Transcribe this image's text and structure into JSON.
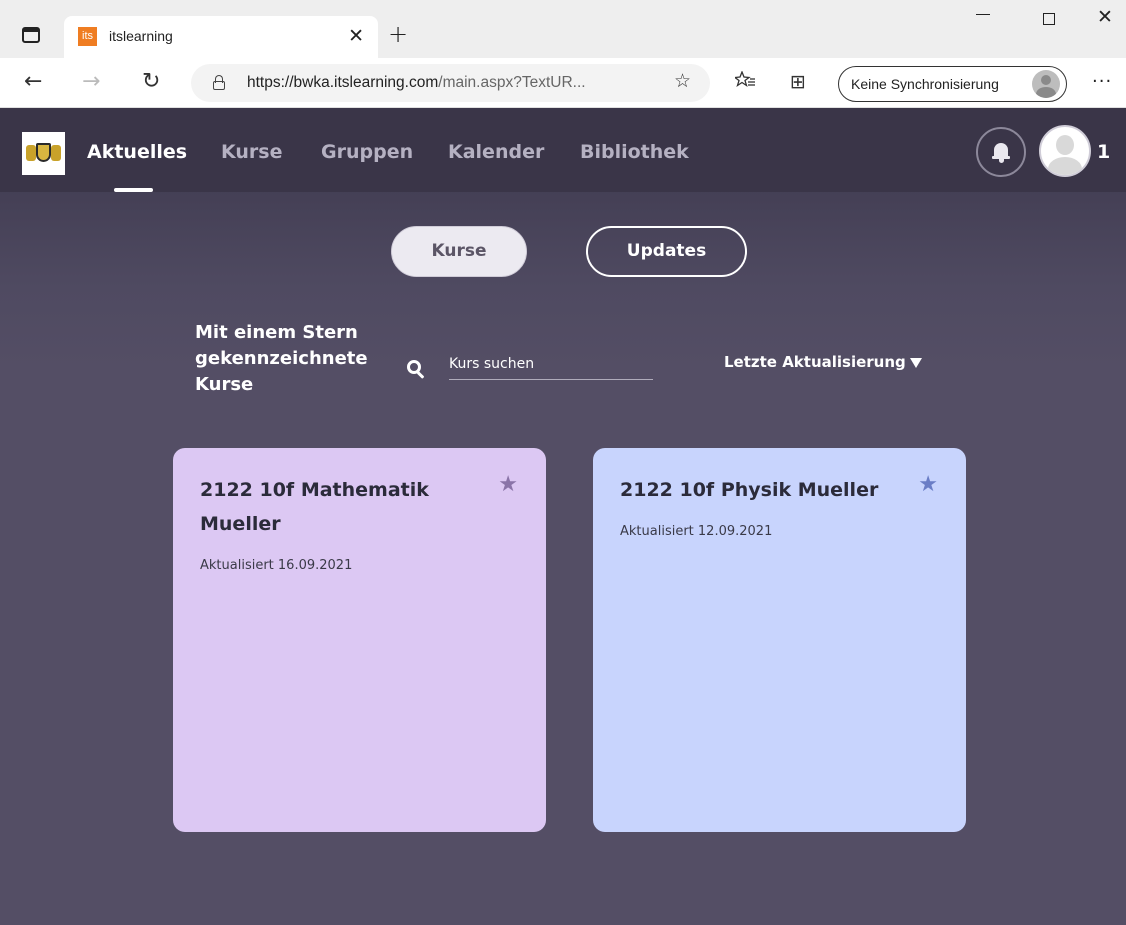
{
  "browser": {
    "tab_favicon_text": "its",
    "tab_title": "itslearning",
    "url_host": "https://bwka.itslearning.com",
    "url_rest": "/main.aspx?TextUR...",
    "sync_label": "Keine Synchronisierung",
    "icons": {
      "back": "←",
      "forward": "→",
      "refresh": "↻",
      "tab_close": "✕",
      "new_tab": "+",
      "window_close": "✕",
      "more": "···",
      "favorites": "☆",
      "collections": "⊞"
    }
  },
  "nav": {
    "items": [
      {
        "label": "Aktuelles",
        "active": true
      },
      {
        "label": "Kurse",
        "active": false
      },
      {
        "label": "Gruppen",
        "active": false
      },
      {
        "label": "Kalender",
        "active": false
      },
      {
        "label": "Bibliothek",
        "active": false
      }
    ],
    "profile_count": "1"
  },
  "toggle": {
    "kurse_label": "Kurse",
    "updates_label": "Updates"
  },
  "section": {
    "title": "Mit einem Stern gekennzeichnete Kurse",
    "search_placeholder": "Kurs suchen",
    "sort_label": "Letzte Aktualisierung"
  },
  "courses": [
    {
      "title": "2122 10f Mathematik Mueller",
      "updated": "Aktualisiert 16.09.2021",
      "starred": true,
      "color": "#dcc8f3"
    },
    {
      "title": "2122 10f Physik Mueller",
      "updated": "Aktualisiert 12.09.2021",
      "starred": true,
      "color": "#c8d4fd"
    }
  ],
  "colors": {
    "nav_bg": "#3a3548",
    "app_bg": "#544e65",
    "accent_white": "#ffffff"
  }
}
